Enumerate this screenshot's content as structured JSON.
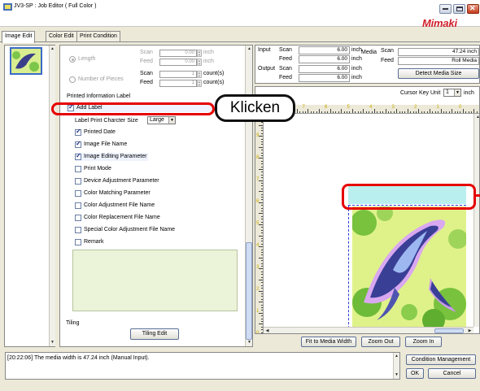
{
  "window": {
    "title": "JV3-SP : Job Editor ( Full Color )",
    "brand": "Mimaki",
    "controls": [
      "minimize",
      "maximize",
      "close"
    ]
  },
  "tabs": [
    "Image Edit",
    "Color Edit",
    "Print Condition"
  ],
  "active_tab": "Image Edit",
  "copies": {
    "length_label": "Length",
    "length_scan_label": "Scan",
    "length_scan_value": "0.00",
    "length_scan_unit": "inch",
    "length_feed_label": "Feed",
    "length_feed_value": "0.00",
    "length_feed_unit": "inch",
    "pieces_label": "Number of Pieces",
    "pieces_scan_label": "Scan",
    "pieces_scan_value": "1",
    "pieces_scan_unit": "count(s)",
    "pieces_feed_label": "Feed",
    "pieces_feed_value": "1",
    "pieces_feed_unit": "count(s)"
  },
  "label_settings": {
    "section_title": "Printed Information Label",
    "add_label": "Add Label",
    "add_label_checked": true,
    "char_size_label": "Label Print Charcter Size",
    "char_size_value": "Large",
    "options": [
      {
        "label": "Printed Date",
        "checked": true
      },
      {
        "label": "Image File Name",
        "checked": true
      },
      {
        "label": "Image Editing Parameter",
        "checked": true
      },
      {
        "label": "Print Mode",
        "checked": false
      },
      {
        "label": "Device Adjustment Parameter",
        "checked": false
      },
      {
        "label": "Color Matching Parameter",
        "checked": false
      },
      {
        "label": "Color Adjustment File Name",
        "checked": false
      },
      {
        "label": "Color Replacement File Name",
        "checked": false
      },
      {
        "label": "Special Color Adjustment File Name",
        "checked": false
      },
      {
        "label": "Remark",
        "checked": false
      }
    ]
  },
  "tiling": {
    "label": "Tiling",
    "button": "Tiling Edit"
  },
  "size_info": {
    "input_label": "Input",
    "input_scan_label": "Scan",
    "input_scan_value": "6.00",
    "input_feed_label": "Feed",
    "input_feed_value": "6.00",
    "output_label": "Output",
    "output_scan_label": "Scan",
    "output_scan_value": "6.00",
    "output_feed_label": "Feed",
    "output_feed_value": "6.00",
    "unit": "inch",
    "media_label": "Media",
    "media_scan_label": "Scan",
    "media_scan_value": "47.24 inch",
    "media_feed_label": "Feed",
    "media_feed_value": "Roll Media",
    "detect_button": "Detect Media Size"
  },
  "preview": {
    "cursor_key_label": "Cursor Key Unit",
    "cursor_key_value": "1",
    "cursor_key_unit": "inch",
    "ruler_h_labels": [
      "8",
      "7",
      "6",
      "5",
      "4",
      "3",
      "2",
      "1",
      "0"
    ],
    "ruler_v_labels": [
      "9",
      "8",
      "7",
      "6",
      "5",
      "4",
      "3",
      "2",
      "1",
      "0"
    ]
  },
  "preview_buttons": [
    "Fit to Media Width",
    "Zoom Out",
    "Zoom In"
  ],
  "status_message": "[20:22:06] The media width is 47.24 inch (Manual Input).",
  "action_buttons": {
    "condition": "Condition Management",
    "ok": "OK",
    "cancel": "Cancel"
  },
  "annotation": {
    "callout_text": "Klicken",
    "callout_color": "#e60000"
  },
  "colors": {
    "label_strip": "#b9f0ef",
    "dashed_border": "#2a3bd8",
    "brand": "#d0202a"
  }
}
